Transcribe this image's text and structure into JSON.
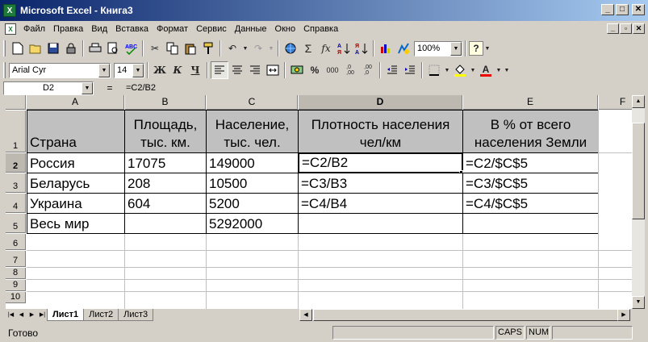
{
  "window": {
    "title": "Microsoft Excel - Книга3",
    "app_icon": "excel-icon",
    "controls": [
      "_",
      "□",
      "✕"
    ]
  },
  "menu": {
    "items": [
      "Файл",
      "Правка",
      "Вид",
      "Вставка",
      "Формат",
      "Сервис",
      "Данные",
      "Окно",
      "Справка"
    ],
    "doc_controls": [
      "_",
      "▫",
      "✕"
    ]
  },
  "toolbar": {
    "zoom": "100%",
    "font": "Arial Cyr",
    "font_size": "14",
    "bold": "Ж",
    "italic": "К",
    "underline": "Ч"
  },
  "formula_bar": {
    "name_box": "D2",
    "equals": "=",
    "formula": "=C2/B2"
  },
  "sheet": {
    "columns": [
      "A",
      "B",
      "C",
      "D",
      "E",
      "F"
    ],
    "selected_column": "D",
    "rows": [
      "1",
      "2",
      "3",
      "4",
      "5",
      "6",
      "7",
      "8",
      "9",
      "10"
    ],
    "selected_row": "2",
    "header_cells": {
      "a": "Страна",
      "b": "Площадь, тыс. км.",
      "c": "Население, тыс. чел.",
      "d": "Плотность населения чел/км",
      "e": "В % от всего населения Земли"
    },
    "data_rows": [
      {
        "a": "Россия",
        "b": "17075",
        "c": "149000",
        "d": "=C2/B2",
        "e": "=C2/$C$5"
      },
      {
        "a": "Беларусь",
        "b": "208",
        "c": "10500",
        "d": "=C3/B3",
        "e": "=C3/$C$5"
      },
      {
        "a": "Украина",
        "b": "604",
        "c": "5200",
        "d": "=C4/B4",
        "e": "=C4/$C$5"
      },
      {
        "a": "Весь мир",
        "b": "",
        "c": "5292000",
        "d": "",
        "e": ""
      }
    ]
  },
  "sheet_tabs": [
    "Лист1",
    "Лист2",
    "Лист3"
  ],
  "active_tab": "Лист1",
  "status": {
    "ready": "Готово",
    "caps": "CAPS",
    "num": "NUM"
  }
}
